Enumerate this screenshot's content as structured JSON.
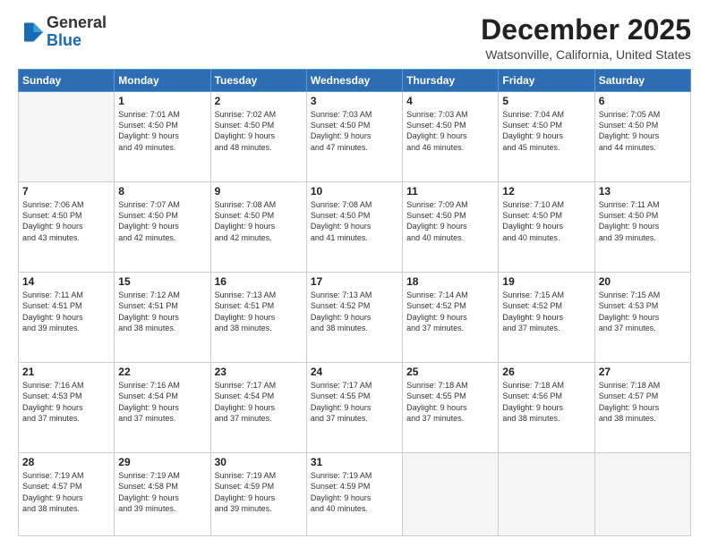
{
  "logo": {
    "general": "General",
    "blue": "Blue"
  },
  "header": {
    "month": "December 2025",
    "location": "Watsonville, California, United States"
  },
  "weekdays": [
    "Sunday",
    "Monday",
    "Tuesday",
    "Wednesday",
    "Thursday",
    "Friday",
    "Saturday"
  ],
  "weeks": [
    [
      {
        "day": "",
        "info": ""
      },
      {
        "day": "1",
        "info": "Sunrise: 7:01 AM\nSunset: 4:50 PM\nDaylight: 9 hours\nand 49 minutes."
      },
      {
        "day": "2",
        "info": "Sunrise: 7:02 AM\nSunset: 4:50 PM\nDaylight: 9 hours\nand 48 minutes."
      },
      {
        "day": "3",
        "info": "Sunrise: 7:03 AM\nSunset: 4:50 PM\nDaylight: 9 hours\nand 47 minutes."
      },
      {
        "day": "4",
        "info": "Sunrise: 7:03 AM\nSunset: 4:50 PM\nDaylight: 9 hours\nand 46 minutes."
      },
      {
        "day": "5",
        "info": "Sunrise: 7:04 AM\nSunset: 4:50 PM\nDaylight: 9 hours\nand 45 minutes."
      },
      {
        "day": "6",
        "info": "Sunrise: 7:05 AM\nSunset: 4:50 PM\nDaylight: 9 hours\nand 44 minutes."
      }
    ],
    [
      {
        "day": "7",
        "info": "Sunrise: 7:06 AM\nSunset: 4:50 PM\nDaylight: 9 hours\nand 43 minutes."
      },
      {
        "day": "8",
        "info": "Sunrise: 7:07 AM\nSunset: 4:50 PM\nDaylight: 9 hours\nand 42 minutes."
      },
      {
        "day": "9",
        "info": "Sunrise: 7:08 AM\nSunset: 4:50 PM\nDaylight: 9 hours\nand 42 minutes."
      },
      {
        "day": "10",
        "info": "Sunrise: 7:08 AM\nSunset: 4:50 PM\nDaylight: 9 hours\nand 41 minutes."
      },
      {
        "day": "11",
        "info": "Sunrise: 7:09 AM\nSunset: 4:50 PM\nDaylight: 9 hours\nand 40 minutes."
      },
      {
        "day": "12",
        "info": "Sunrise: 7:10 AM\nSunset: 4:50 PM\nDaylight: 9 hours\nand 40 minutes."
      },
      {
        "day": "13",
        "info": "Sunrise: 7:11 AM\nSunset: 4:50 PM\nDaylight: 9 hours\nand 39 minutes."
      }
    ],
    [
      {
        "day": "14",
        "info": "Sunrise: 7:11 AM\nSunset: 4:51 PM\nDaylight: 9 hours\nand 39 minutes."
      },
      {
        "day": "15",
        "info": "Sunrise: 7:12 AM\nSunset: 4:51 PM\nDaylight: 9 hours\nand 38 minutes."
      },
      {
        "day": "16",
        "info": "Sunrise: 7:13 AM\nSunset: 4:51 PM\nDaylight: 9 hours\nand 38 minutes."
      },
      {
        "day": "17",
        "info": "Sunrise: 7:13 AM\nSunset: 4:52 PM\nDaylight: 9 hours\nand 38 minutes."
      },
      {
        "day": "18",
        "info": "Sunrise: 7:14 AM\nSunset: 4:52 PM\nDaylight: 9 hours\nand 37 minutes."
      },
      {
        "day": "19",
        "info": "Sunrise: 7:15 AM\nSunset: 4:52 PM\nDaylight: 9 hours\nand 37 minutes."
      },
      {
        "day": "20",
        "info": "Sunrise: 7:15 AM\nSunset: 4:53 PM\nDaylight: 9 hours\nand 37 minutes."
      }
    ],
    [
      {
        "day": "21",
        "info": "Sunrise: 7:16 AM\nSunset: 4:53 PM\nDaylight: 9 hours\nand 37 minutes."
      },
      {
        "day": "22",
        "info": "Sunrise: 7:16 AM\nSunset: 4:54 PM\nDaylight: 9 hours\nand 37 minutes."
      },
      {
        "day": "23",
        "info": "Sunrise: 7:17 AM\nSunset: 4:54 PM\nDaylight: 9 hours\nand 37 minutes."
      },
      {
        "day": "24",
        "info": "Sunrise: 7:17 AM\nSunset: 4:55 PM\nDaylight: 9 hours\nand 37 minutes."
      },
      {
        "day": "25",
        "info": "Sunrise: 7:18 AM\nSunset: 4:55 PM\nDaylight: 9 hours\nand 37 minutes."
      },
      {
        "day": "26",
        "info": "Sunrise: 7:18 AM\nSunset: 4:56 PM\nDaylight: 9 hours\nand 38 minutes."
      },
      {
        "day": "27",
        "info": "Sunrise: 7:18 AM\nSunset: 4:57 PM\nDaylight: 9 hours\nand 38 minutes."
      }
    ],
    [
      {
        "day": "28",
        "info": "Sunrise: 7:19 AM\nSunset: 4:57 PM\nDaylight: 9 hours\nand 38 minutes."
      },
      {
        "day": "29",
        "info": "Sunrise: 7:19 AM\nSunset: 4:58 PM\nDaylight: 9 hours\nand 39 minutes."
      },
      {
        "day": "30",
        "info": "Sunrise: 7:19 AM\nSunset: 4:59 PM\nDaylight: 9 hours\nand 39 minutes."
      },
      {
        "day": "31",
        "info": "Sunrise: 7:19 AM\nSunset: 4:59 PM\nDaylight: 9 hours\nand 40 minutes."
      },
      {
        "day": "",
        "info": ""
      },
      {
        "day": "",
        "info": ""
      },
      {
        "day": "",
        "info": ""
      }
    ]
  ]
}
